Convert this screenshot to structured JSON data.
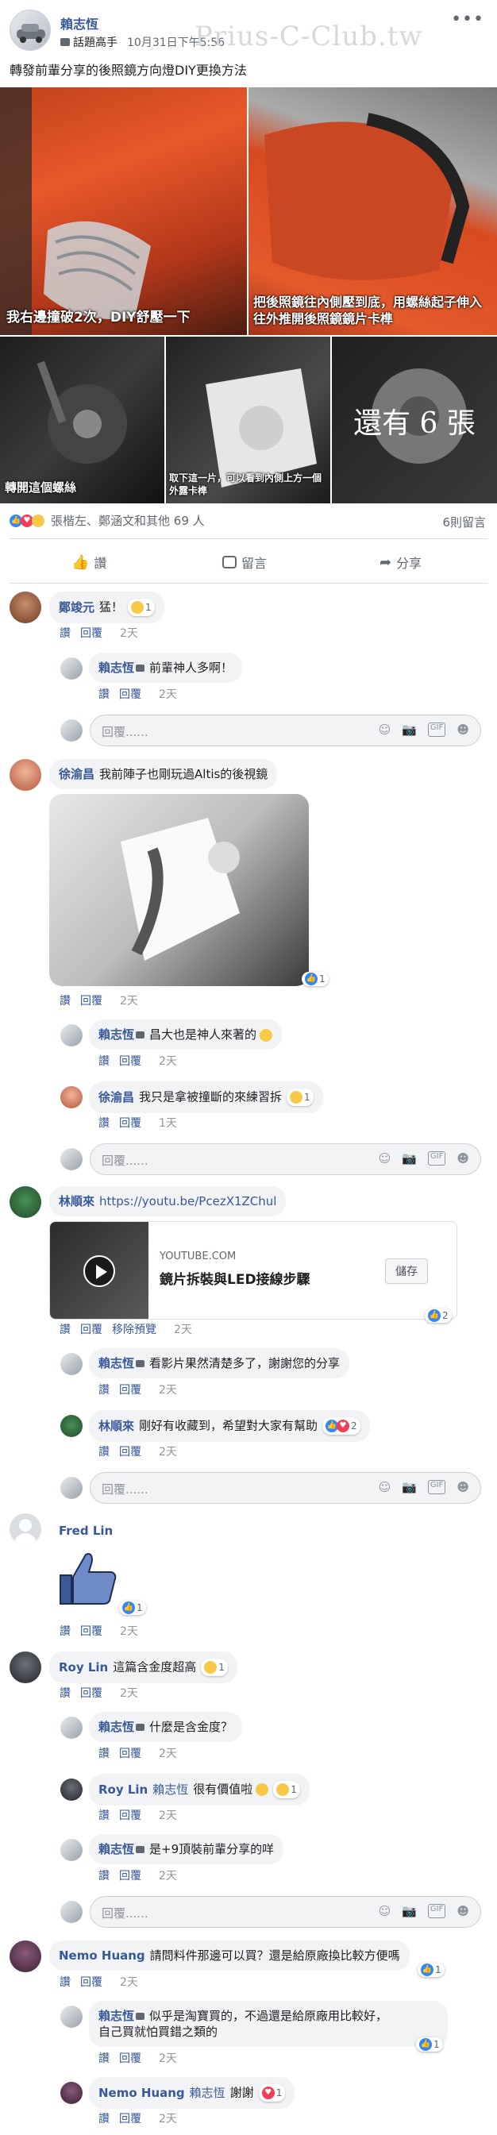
{
  "post": {
    "author": "賴志恆",
    "badge_label": "話題高手",
    "time": "10月31日下午5:56",
    "watermark": "Prius-C-Club.tw",
    "text": "轉發前輩分享的後照鏡方向燈DIY更換方法",
    "captions": {
      "p1": "我右邊撞破2次，DIY舒壓一下",
      "p2": "把後照鏡往內側壓到底，用螺絲起子伸入往外推開後照鏡鏡片卡榫",
      "p3": "轉開這個螺絲",
      "p4": "取下這一片，可以看到內側上方一個外露卡榫",
      "p5_more": "還有 6 張"
    },
    "reactions_text": "張楷左、鄭涵文和其他 69 人",
    "comments_count": "6則留言",
    "actions": {
      "like": "讚",
      "comment": "留言",
      "share": "分享"
    }
  },
  "labels": {
    "like": "讚",
    "reply": "回覆",
    "hide_preview": "移除預覽",
    "reply_placeholder": "回覆......",
    "save": "儲存"
  },
  "comments": [
    {
      "name": "鄭竣元",
      "text": "猛！",
      "count": "1",
      "time": "2天"
    },
    {
      "name": "賴志恆",
      "badge": "",
      "text": "前輩神人多啊！",
      "time": "2天"
    },
    {
      "name": "徐渝昌",
      "text": "我前陣子也剛玩過Altis的後視鏡",
      "count": "1",
      "time": "2天"
    },
    {
      "name": "賴志恆",
      "text": "昌大也是神人來著的",
      "time": "2天"
    },
    {
      "name": "徐渝昌",
      "text": "我只是拿被撞斷的來練習拆",
      "count": "1",
      "time": "1天"
    },
    {
      "name": "林順來",
      "text": "https://youtu.be/PcezX1ZChul",
      "count": "2",
      "time": "2天",
      "card": {
        "site": "YOUTUBE.COM",
        "title": "鏡片拆裝與LED接線步驟"
      }
    },
    {
      "name": "賴志恆",
      "text": "看影片果然清楚多了，謝謝您的分享",
      "time": "2天"
    },
    {
      "name": "林順來",
      "text": "剛好有收藏到，希望對大家有幫助",
      "count": "2",
      "time": "2天"
    },
    {
      "name": "Fred Lin",
      "text": "",
      "count": "1",
      "time": "2天"
    },
    {
      "name": "Roy Lin",
      "text": "這篇含金度超高",
      "count": "1",
      "time": "2天"
    },
    {
      "name": "賴志恆",
      "text": "什麼是含金度？",
      "time": "2天"
    },
    {
      "name": "Roy Lin",
      "mention": "賴志恆",
      "text": "很有價值啦",
      "count": "1",
      "time": "2天"
    },
    {
      "name": "賴志恆",
      "text": "是+9頂裝前輩分享的咩",
      "time": "2天"
    },
    {
      "name": "Nemo Huang",
      "text": "請問料件那邊可以買？還是給原廠換比較方便嗎",
      "count": "1",
      "time": "2天"
    },
    {
      "name": "賴志恆",
      "text1": "似乎是淘寶買的，不過還是給原廠用比較好，",
      "text2": "自己買就怕買錯之類的",
      "count": "1",
      "time": "2天"
    },
    {
      "name": "Nemo Huang",
      "mention": "賴志恆",
      "text": "謝謝",
      "count": "1",
      "time": "2天"
    }
  ],
  "colors": {
    "link": "#385898",
    "like_blue": "#2d88ff",
    "bubble": "#f2f3f5"
  }
}
